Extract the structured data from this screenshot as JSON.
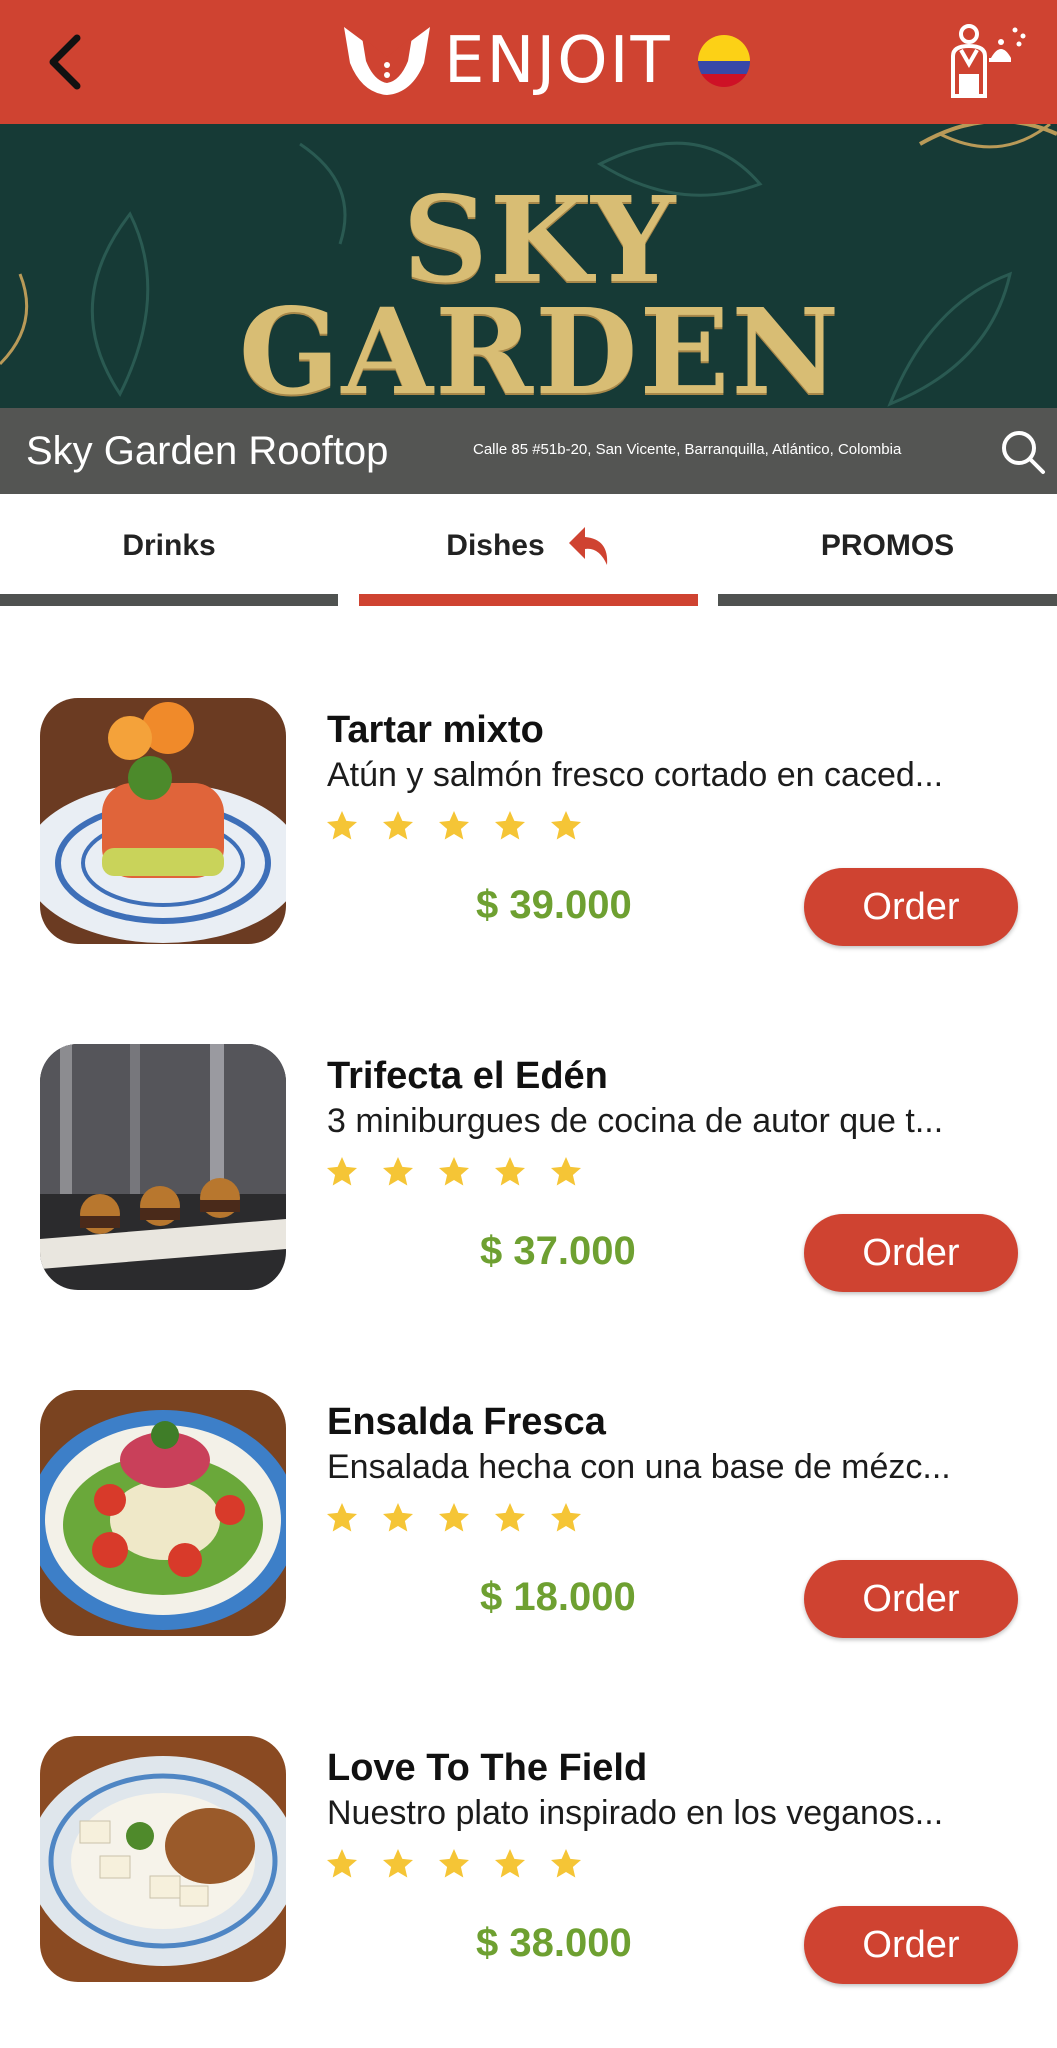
{
  "header": {
    "back_icon": "chevron-left-icon",
    "logo_text": "ENJOIT",
    "flag": "colombia-flag",
    "waiter_icon": "waiter-service-icon",
    "brand_color": "#cf4331"
  },
  "banner": {
    "title_line1": "SKY",
    "title_line2": "GARDEN"
  },
  "restaurant": {
    "name": "Sky Garden Rooftop",
    "address": "Calle 85 #51b-20, San Vicente, Barranquilla, Atlántico, Colombia",
    "search_icon": "search-icon"
  },
  "tabs": [
    {
      "label": "Drinks",
      "active": false
    },
    {
      "label": "Dishes",
      "active": true,
      "icon": "reply-arrow-icon"
    },
    {
      "label": "PROMOS",
      "active": false
    }
  ],
  "dishes": [
    {
      "name": "Tartar mixto",
      "description": "Atún y salmón fresco cortado en caced...",
      "rating": 5,
      "price": "$ 39.000",
      "order_label": "Order"
    },
    {
      "name": "Trifecta el Edén",
      "description": "3 miniburgues de cocina de autor que t...",
      "rating": 5,
      "price": "$ 37.000",
      "order_label": "Order"
    },
    {
      "name": "Ensalda Fresca",
      "description": "Ensalada hecha con una base de mézc...",
      "rating": 5,
      "price": "$ 18.000",
      "order_label": "Order"
    },
    {
      "name": "Love To The Field",
      "description": "Nuestro plato inspirado en los veganos...",
      "rating": 5,
      "price": "$ 38.000",
      "order_label": "Order"
    }
  ],
  "colors": {
    "accent": "#cf4331",
    "price": "#6ea031",
    "star": "#f5c536",
    "info_bar": "#545553",
    "banner_bg": "#163a36",
    "banner_gold": "#d8bd74"
  }
}
